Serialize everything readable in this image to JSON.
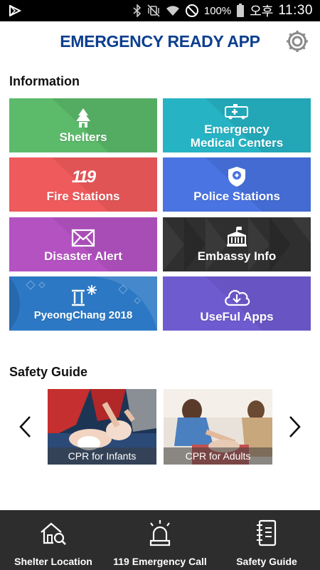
{
  "status_bar": {
    "battery": "100%",
    "period": "오후",
    "time": "11:30"
  },
  "header": {
    "title": "EMERGENCY READY APP"
  },
  "information": {
    "title": "Information",
    "tiles": [
      {
        "label": "Shelters",
        "color": "#5cba6b"
      },
      {
        "label": "Emergency\nMedical Centers",
        "color": "#26b3c4"
      },
      {
        "label": "Fire Stations",
        "color": "#ef5a5c"
      },
      {
        "label": "Police Stations",
        "color": "#4a74e2"
      },
      {
        "label": "Disaster Alert",
        "color": "#b452c2"
      },
      {
        "label": "Embassy Info",
        "color": "#2f2f2f"
      },
      {
        "label": "PyeongChang 2018",
        "color": "#2c78c4"
      },
      {
        "label": "UseFul Apps",
        "color": "#6f5bd0"
      }
    ],
    "tile_icons": {
      "fire_stations": "119"
    }
  },
  "safety_guide": {
    "title": "Safety Guide",
    "cards": [
      {
        "label": "CPR for Infants"
      },
      {
        "label": "CPR for Adults"
      }
    ]
  },
  "bottom_nav": {
    "items": [
      {
        "label": "Shelter Location",
        "icon": "house-search-icon"
      },
      {
        "label": "119 Emergency Call",
        "icon": "siren-icon"
      },
      {
        "label": "Safety Guide",
        "icon": "notebook-icon"
      }
    ]
  }
}
